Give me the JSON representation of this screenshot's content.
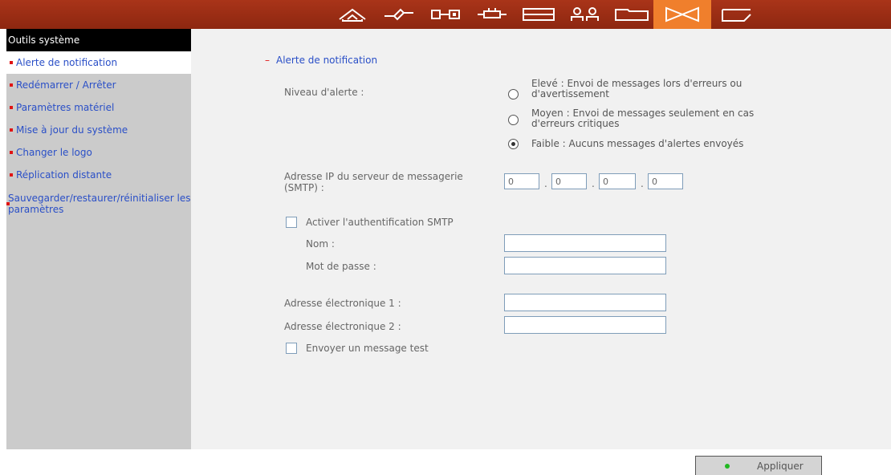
{
  "colors": {
    "topbar": "#9a2e14",
    "active_tab": "#f07f2c",
    "sidebar": "#cbcbcb",
    "link": "#2a4fc7",
    "bullet": "#e01414",
    "main_bg": "#f1f1f1"
  },
  "topnav": [
    {
      "icon": "home-icon"
    },
    {
      "icon": "network-icon"
    },
    {
      "icon": "device-icon"
    },
    {
      "icon": "plugin-icon"
    },
    {
      "icon": "storage-icon"
    },
    {
      "icon": "users-icon"
    },
    {
      "icon": "folder-icon"
    },
    {
      "icon": "system-tools-icon",
      "active": true
    },
    {
      "icon": "log-icon"
    }
  ],
  "sidebar": {
    "title": "Outils système",
    "items": [
      {
        "label": "Alerte de notification"
      },
      {
        "label": "Redémarrer / Arrêter"
      },
      {
        "label": "Paramètres matériel"
      },
      {
        "label": "Mise à jour du système"
      },
      {
        "label": "Changer le logo"
      },
      {
        "label": "Réplication distante"
      },
      {
        "label": "Sauvegarder/restaurer/réinitialiser les paramètres"
      }
    ]
  },
  "main": {
    "section_title": "Alerte de notification",
    "alert_level_label": "Niveau d'alerte :",
    "alert_options": [
      {
        "label": "Elevé : Envoi de messages lors d'erreurs ou d'avertissement",
        "checked": false
      },
      {
        "label": "Moyen : Envoi de messages seulement en cas d'erreurs critiques",
        "checked": false
      },
      {
        "label": "Faible : Aucuns messages d'alertes envoyés",
        "checked": true
      }
    ],
    "smtp_label": "Adresse IP du serveur de messagerie (SMTP) :",
    "smtp_ip": [
      "0",
      "0",
      "0",
      "0"
    ],
    "ip_separator": ".",
    "auth_label": "Activer l'authentification SMTP",
    "name_label": "Nom :",
    "name_value": "",
    "password_label": "Mot de passe :",
    "password_value": "",
    "email1_label": "Adresse électronique 1 :",
    "email1_value": "",
    "email2_label": "Adresse électronique 2 :",
    "email2_value": "",
    "test_label": "Envoyer un message test",
    "apply_label": "Appliquer"
  }
}
